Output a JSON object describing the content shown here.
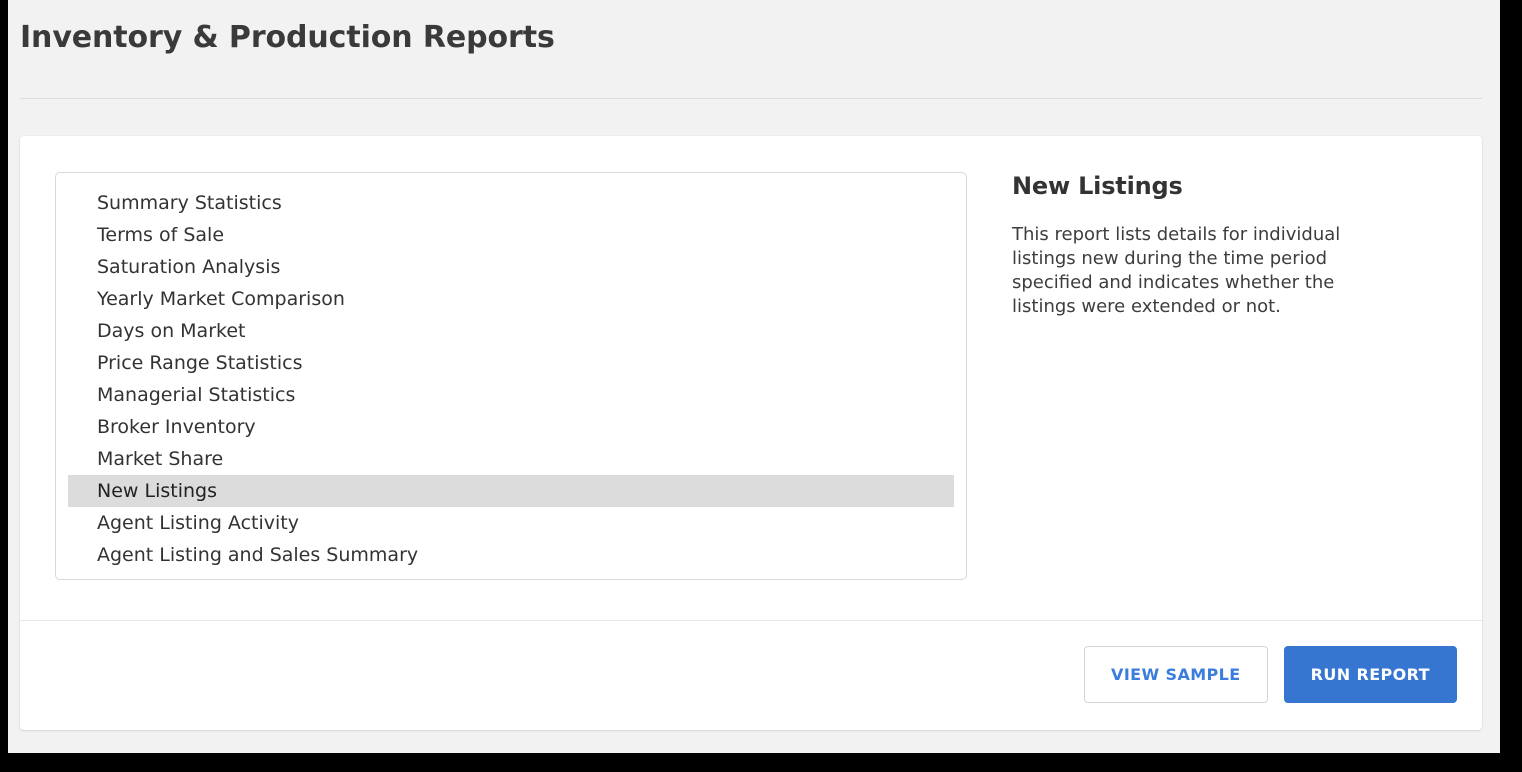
{
  "header": {
    "title": "Inventory & Production Reports"
  },
  "report_list": {
    "selected_index": 9,
    "items": [
      {
        "label": "Summary Statistics"
      },
      {
        "label": "Terms of Sale"
      },
      {
        "label": "Saturation Analysis"
      },
      {
        "label": "Yearly Market Comparison"
      },
      {
        "label": "Days on Market"
      },
      {
        "label": "Price Range Statistics"
      },
      {
        "label": "Managerial Statistics"
      },
      {
        "label": "Broker Inventory"
      },
      {
        "label": "Market Share"
      },
      {
        "label": "New Listings"
      },
      {
        "label": "Agent Listing Activity"
      },
      {
        "label": "Agent Listing and Sales Summary"
      }
    ]
  },
  "detail": {
    "title": "New Listings",
    "description": "This report lists details for individual listings new during the time period specified and indicates whether the listings were extended or not."
  },
  "footer": {
    "view_sample_label": "VIEW SAMPLE",
    "run_report_label": "RUN REPORT"
  },
  "colors": {
    "primary": "#3676d0",
    "link": "#3b7ddd",
    "page_background": "#f2f2f2",
    "card_background": "#ffffff",
    "selected_row": "#dcdcdc",
    "text": "#333333"
  }
}
